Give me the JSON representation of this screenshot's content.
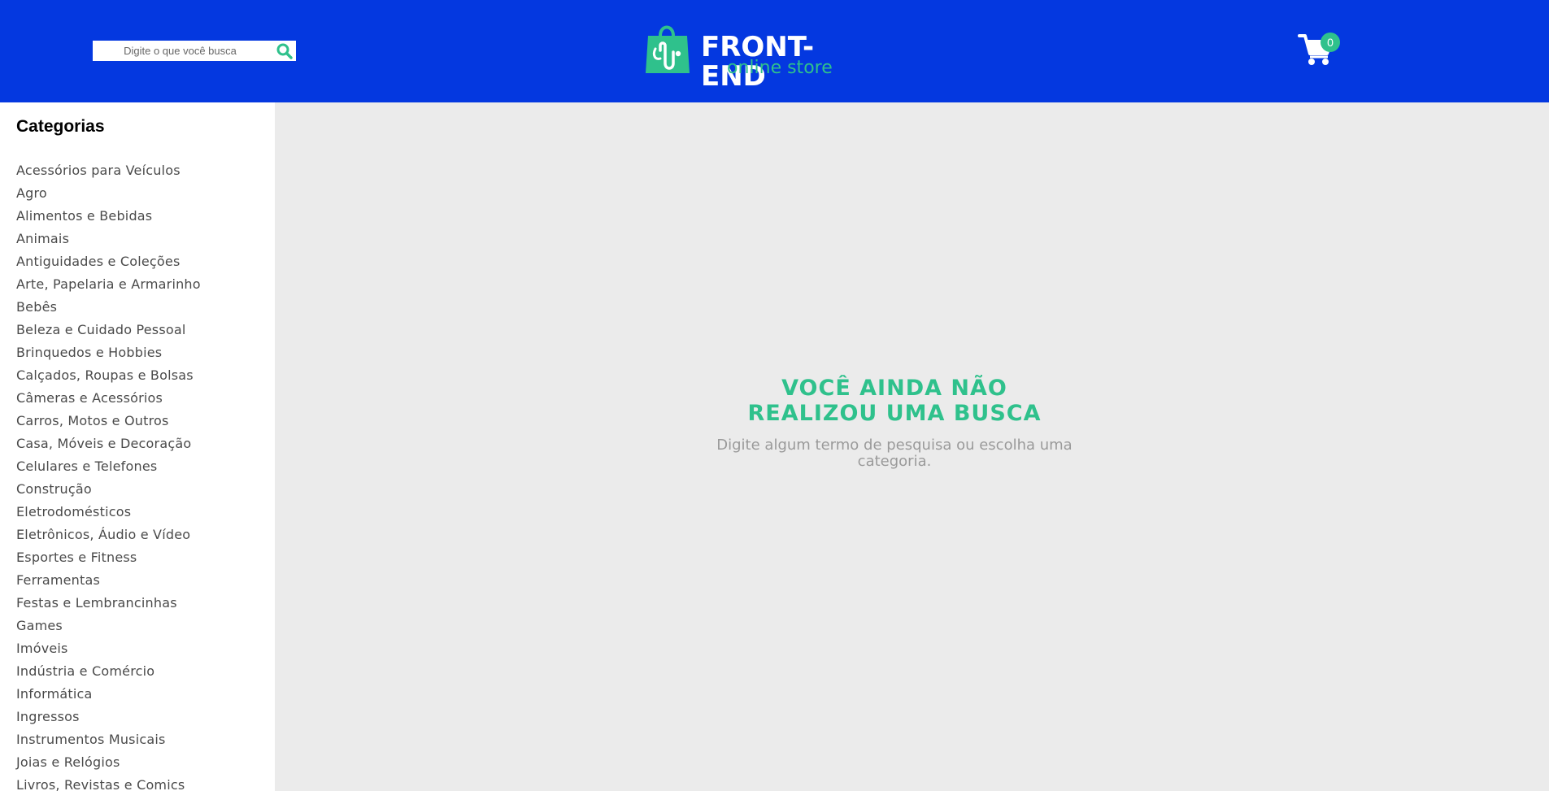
{
  "header": {
    "search": {
      "placeholder": "Digite o que você busca",
      "value": ""
    },
    "search_icon": "search-icon",
    "logo": {
      "title": "FRONT-END",
      "subtitle": "online store",
      "icon": "shopping-bag-icon"
    },
    "cart": {
      "icon": "cart-icon",
      "count": "0"
    }
  },
  "sidebar": {
    "title": "Categorias",
    "categories": [
      "Acessórios para Veículos",
      "Agro",
      "Alimentos e Bebidas",
      "Animais",
      "Antiguidades e Coleções",
      "Arte, Papelaria e Armarinho",
      "Bebês",
      "Beleza e Cuidado Pessoal",
      "Brinquedos e Hobbies",
      "Calçados, Roupas e Bolsas",
      "Câmeras e Acessórios",
      "Carros, Motos e Outros",
      "Casa, Móveis e Decoração",
      "Celulares e Telefones",
      "Construção",
      "Eletrodomésticos",
      "Eletrônicos, Áudio e Vídeo",
      "Esportes e Fitness",
      "Ferramentas",
      "Festas e Lembrancinhas",
      "Games",
      "Imóveis",
      "Indústria e Comércio",
      "Informática",
      "Ingressos",
      "Instrumentos Musicais",
      "Joias e Relógios",
      "Livros, Revistas e Comics"
    ]
  },
  "main": {
    "empty_title": "VOCÊ AINDA NÃO REALIZOU UMA BUSCA",
    "empty_subtitle": "Digite algum termo de pesquisa ou escolha uma categoria."
  },
  "colors": {
    "header": "#0438e0",
    "accent": "#2fc18c",
    "background": "#ebebeb"
  }
}
